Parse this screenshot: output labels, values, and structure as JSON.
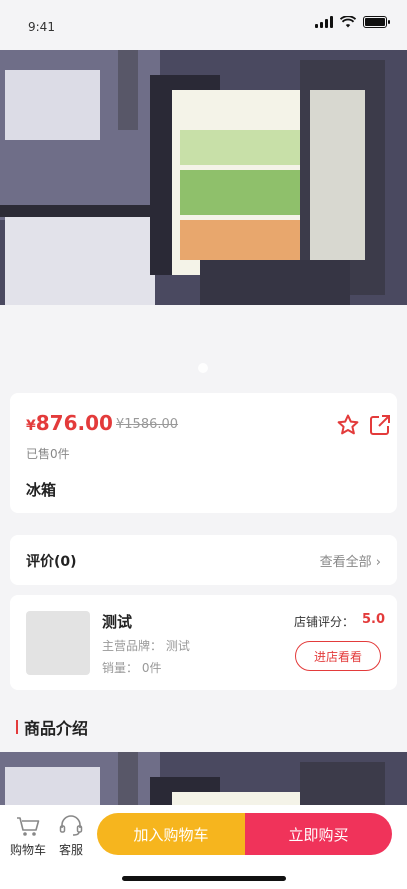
{
  "status": {
    "time": "9:41"
  },
  "product": {
    "currency": "¥",
    "price": "876.00",
    "original_price": "¥1586.00",
    "sold": "已售0件",
    "title": "冰箱"
  },
  "reviews": {
    "title": "评价(0)",
    "view_all": "查看全部"
  },
  "shop": {
    "name": "测试",
    "brand": "主营品牌： 测试",
    "sales": "销量： 0件",
    "score_label": "店铺评分：",
    "score": "5.0",
    "visit_label": "进店看看"
  },
  "section": {
    "title": "商品介绍"
  },
  "bottom": {
    "cart_label": "购物车",
    "service_label": "客服",
    "add_to_cart": "加入购物车",
    "buy_now": "立即购买"
  },
  "colors": {
    "accent": "#e33b3b",
    "cart_btn": "#f6b51e",
    "buy_btn": "#f0335a"
  }
}
